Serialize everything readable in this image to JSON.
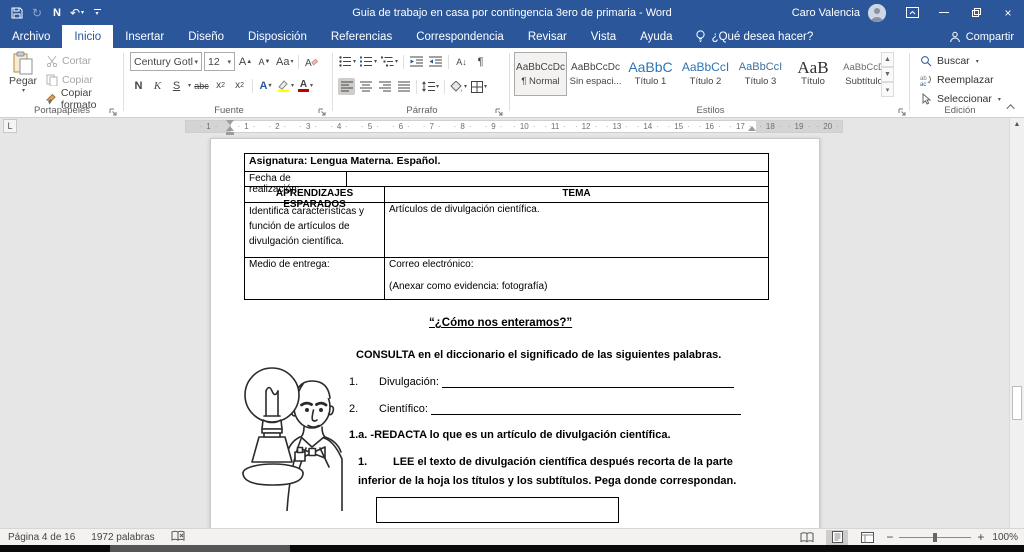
{
  "titlebar": {
    "title": "Guia de trabajo en casa por contingencia 3ero de primaria  -  Word",
    "user": "Caro Valencia",
    "qat_n": "N"
  },
  "tabs": {
    "items": [
      "Archivo",
      "Inicio",
      "Insertar",
      "Diseño",
      "Disposición",
      "Referencias",
      "Correspondencia",
      "Revisar",
      "Vista",
      "Ayuda"
    ],
    "active_index": 1,
    "search": "¿Qué desea hacer?",
    "share": "Compartir"
  },
  "ribbon": {
    "clipboard": {
      "group": "Portapapeles",
      "paste": "Pegar",
      "cut": "Cortar",
      "copy": "Copiar",
      "format": "Copiar formato"
    },
    "font": {
      "group": "Fuente",
      "family": "Century Gotl",
      "size": "12",
      "bold": "N",
      "italic": "K",
      "underline": "S",
      "strike": "abc",
      "subscript": "x",
      "superscript": "x",
      "case_btn": "Aa",
      "effects": "A",
      "color": "A"
    },
    "paragraph": {
      "group": "Párrafo",
      "sort": "A",
      "pilcrow": "¶"
    },
    "styles": {
      "group": "Estilos",
      "selected_index": 0,
      "items": [
        {
          "preview": "AaBbCcDc",
          "name": "¶ Normal"
        },
        {
          "preview": "AaBbCcDc",
          "name": "Sin espaci..."
        },
        {
          "preview": "AaBbC",
          "name": "Título 1"
        },
        {
          "preview": "AaBbCcI",
          "name": "Título 2"
        },
        {
          "preview": "AaBbCcI",
          "name": "Título 3"
        },
        {
          "preview": "AaB",
          "name": "Título"
        },
        {
          "preview": "AaBbCcD",
          "name": "Subtítulo"
        }
      ]
    },
    "editing": {
      "group": "Edición",
      "find": "Buscar",
      "replace": "Reemplazar",
      "select": "Seleccionar"
    }
  },
  "ruler": {
    "left": "1",
    "units": [
      "1",
      "2",
      "3",
      "4",
      "5",
      "6",
      "7",
      "8",
      "9",
      "10",
      "11",
      "12",
      "13",
      "14",
      "15",
      "16",
      "17"
    ],
    "right": [
      "18",
      "19",
      "20"
    ]
  },
  "document": {
    "table": {
      "row1": "Asignatura: Lengua Materna. Español.",
      "row2_left": "Fecha de realización:",
      "header_left": "APRENDIZAJES ESPARADOS",
      "header_right": "TEMA",
      "row4_left": "Identifica características y función de artículos de divulgación científica.",
      "row4_right": "Artículos de divulgación científica.",
      "row5_left": "Medio de entrega:",
      "row5_right1": "Correo electrónico:",
      "row5_right2": "(Anexar como evidencia: fotografía)"
    },
    "title": "“¿Cómo nos enteramos?”",
    "consulta": "CONSULTA en el diccionario el significado de las siguientes palabras.",
    "item1_num": "1.",
    "item1_label": "Divulgación:",
    "item2_num": "2.",
    "item2_label": "Científico:",
    "redacta": "1.a. -REDACTA lo que es un artículo de divulgación científica.",
    "lee_num": "1.",
    "lee_line1": "LEE el texto de divulgación científica después recorta de la parte",
    "lee_line2": "inferior de la hoja los títulos y los subtítulos. Pega donde correspondan."
  },
  "statusbar": {
    "page": "Página 4 de 16",
    "words": "1972 palabras",
    "zoom": "100%"
  },
  "colors": {
    "titlebar": "#2b579a",
    "heading_blue": "#2e74b5",
    "highlight": "#ffff00",
    "font_color": "#c00000"
  }
}
